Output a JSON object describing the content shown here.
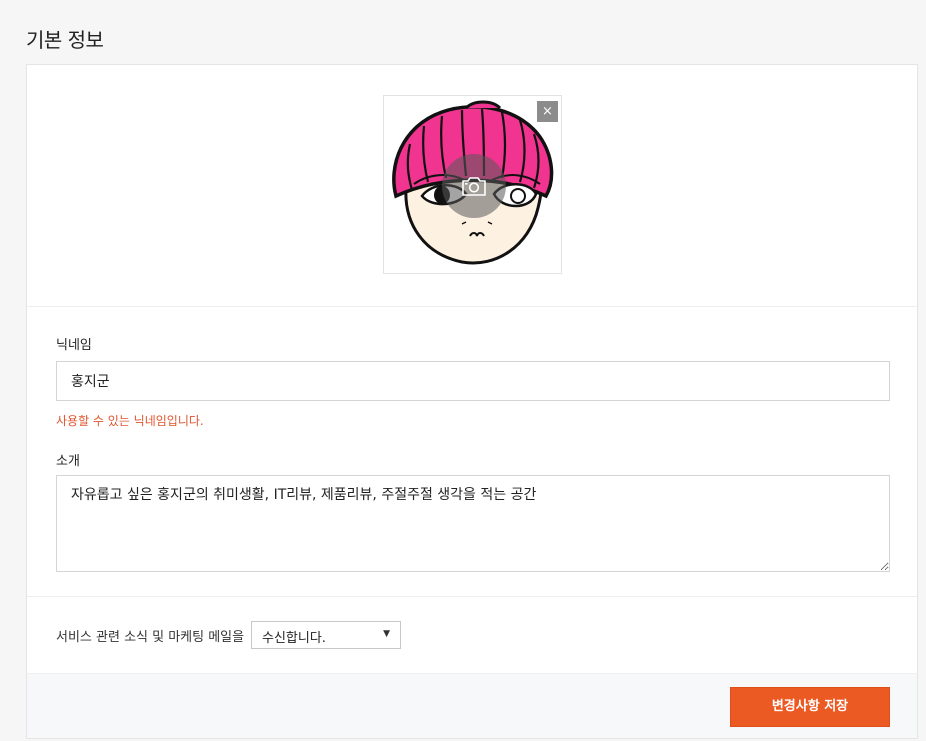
{
  "header": {
    "title": "기본 정보"
  },
  "profile_image": {
    "remove_label": "×",
    "remove_icon": "close-icon",
    "upload_icon": "camera-icon"
  },
  "nickname": {
    "label": "닉네임",
    "value": "홍지군",
    "helper": "사용할 수 있는 닉네임입니다."
  },
  "intro": {
    "label": "소개",
    "value": "자유롭고 싶은 홍지군의 취미생활, IT리뷰, 제품리뷰, 주절주절 생각을 적는 공간"
  },
  "marketing": {
    "label": "서비스 관련 소식 및 마케팅 메일을",
    "selected": "수신합니다.",
    "arrow": "▼"
  },
  "footer": {
    "save_label": "변경사항 저장"
  },
  "colors": {
    "accent": "#ec5a24",
    "helper_text": "#e0552f",
    "hat_pink": "#f0348f"
  }
}
